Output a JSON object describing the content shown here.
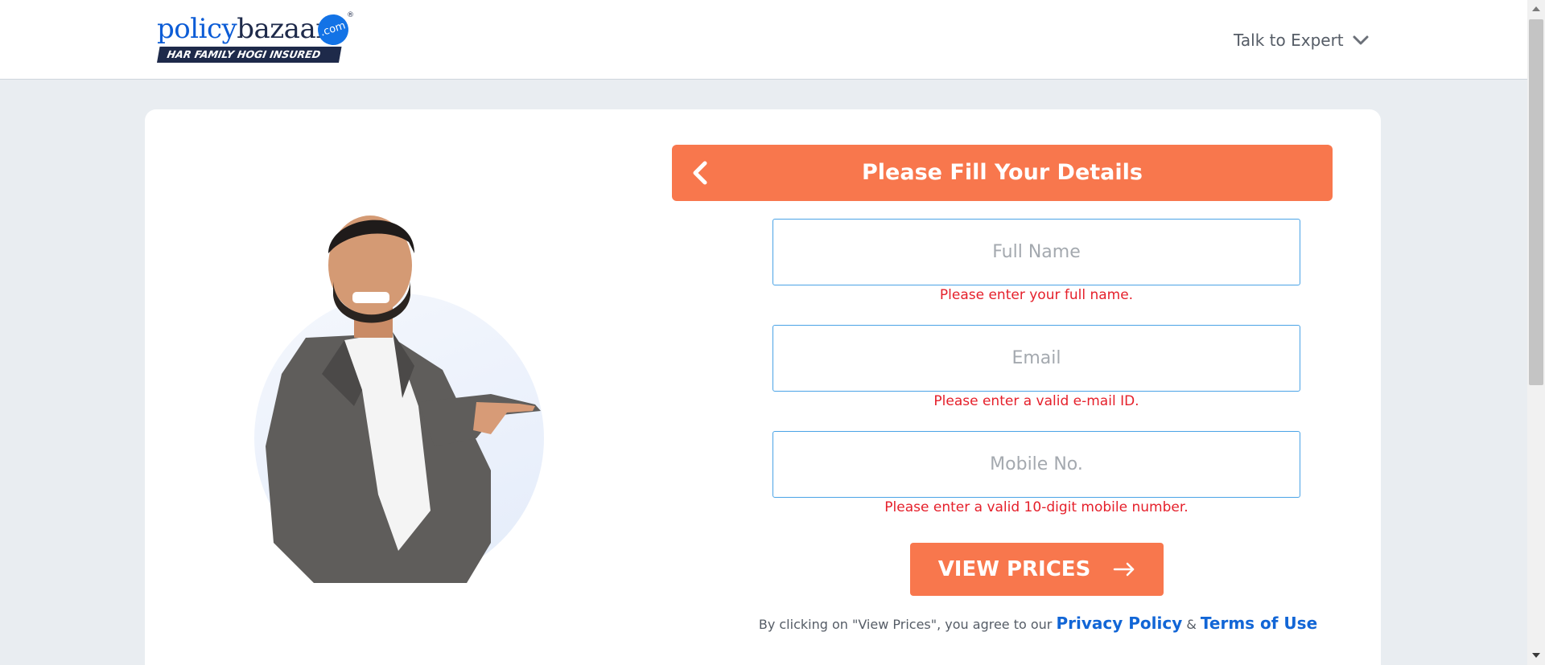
{
  "header": {
    "logo": {
      "word_policy": "policy",
      "word_bazaar": "bazaar",
      "badge": ".com",
      "registered": "®",
      "tagline": "HAR FAMILY HOGI INSURED"
    },
    "talk_to_expert": "Talk to Expert"
  },
  "form": {
    "title": "Please Fill Your Details",
    "fields": {
      "full_name": {
        "placeholder": "Full Name",
        "value": "",
        "error": "Please enter your full name."
      },
      "email": {
        "placeholder": "Email",
        "value": "",
        "error": "Please enter a valid e-mail ID."
      },
      "mobile": {
        "placeholder": "Mobile No.",
        "value": "",
        "error": "Please enter a valid 10-digit mobile number."
      }
    },
    "submit_label": "VIEW PRICES",
    "consent": {
      "prefix": "By clicking on \"View Prices\", you agree to our ",
      "privacy": "Privacy Policy",
      "amp": " & ",
      "terms": "Terms of Use"
    }
  },
  "icons": {
    "back": "chevron-left-icon",
    "dropdown": "chevron-down-icon",
    "submit": "arrow-right-icon"
  },
  "colors": {
    "accent": "#f8774d",
    "link": "#1266d6",
    "error": "#e5202b",
    "field_border": "#4aa3e6",
    "brand_dark": "#1e2a4a",
    "brand_blue": "#0c5cd6"
  }
}
